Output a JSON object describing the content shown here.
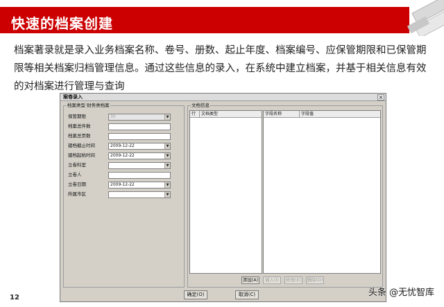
{
  "slide": {
    "title": "快速的档案创建",
    "intro": "档案著录就是录入业务档案名称、卷号、册数、起止年度、档案编号、应保管期限和已保管期限等相关档案归档管理信息。通过这些信息的录入，在系统中建立档案，并基于相关信息有效的对档案进行管理与查询",
    "page_number": "12",
    "watermark": "头条 @无忧智库"
  },
  "dialog": {
    "title": "案卷录入",
    "close_glyph": "×",
    "archive_group_label": "档案类型 财务类档案",
    "fields": [
      {
        "label": "保管期限",
        "value": "30",
        "dropdown": true,
        "disabled": true
      },
      {
        "label": "档案总件数",
        "value": ""
      },
      {
        "label": "档案总页数",
        "value": ""
      },
      {
        "label": "建档截止时间",
        "value": "2009-12-22",
        "dropdown": true
      },
      {
        "label": "建档起始时间",
        "value": "2009-12-22",
        "dropdown": true
      },
      {
        "label": "立卷科室",
        "value": "",
        "dropdown": true
      },
      {
        "label": "立卷人",
        "value": ""
      },
      {
        "label": "立卷日期",
        "value": "2009-12-22",
        "dropdown": true
      },
      {
        "label": "所属市区",
        "value": "",
        "dropdown": true
      }
    ],
    "doc_group_label": "文档信息",
    "doc_columns": [
      "行",
      "文档类型"
    ],
    "field_columns": [
      "字段名称",
      "字段值"
    ],
    "grid_buttons": [
      {
        "label": "添加(A)",
        "enabled": true
      },
      {
        "label": "插入(I)",
        "enabled": false
      },
      {
        "label": "修改(E)",
        "enabled": false
      },
      {
        "label": "删除(D)",
        "enabled": false
      }
    ],
    "confirm_label": "确定(O)",
    "cancel_label": "取消(C)"
  },
  "icons": [
    "close-icon",
    "dropdown-arrow-icon"
  ],
  "colors": {
    "title_bar": "#cc0000",
    "dialog_face": "#d4d0c8"
  }
}
